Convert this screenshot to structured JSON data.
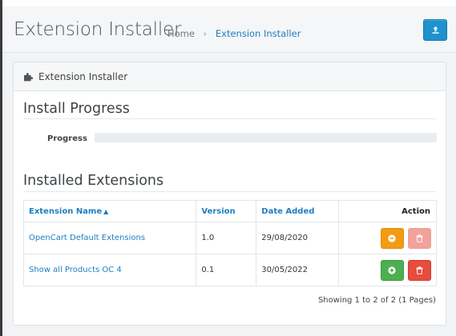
{
  "header": {
    "title": "Extension Installer",
    "breadcrumb": [
      {
        "label": "Home"
      },
      {
        "label": "Extension Installer"
      }
    ],
    "upload_icon": "upload-icon",
    "accent": "#1e91cf"
  },
  "panel": {
    "heading": "Extension Installer",
    "heading_icon": "puzzle-icon"
  },
  "install_progress": {
    "title": "Install Progress",
    "label": "Progress",
    "value_percent": 0
  },
  "installed": {
    "title": "Installed Extensions",
    "columns": {
      "name": "Extension Name",
      "version": "Version",
      "date_added": "Date Added",
      "action": "Action"
    },
    "rows": [
      {
        "name": "OpenCart Default Extensions",
        "version": "1.0",
        "date_added": "29/08/2020",
        "primary_action": {
          "icon": "minus-circle-icon",
          "style": "warning",
          "color": "#f39c12"
        },
        "delete_action": {
          "icon": "trash-icon",
          "style": "danger",
          "disabled": true,
          "color": "#f2a29a"
        }
      },
      {
        "name": "Show all Products OC 4",
        "version": "0.1",
        "date_added": "30/05/2022",
        "primary_action": {
          "icon": "plus-circle-icon",
          "style": "success",
          "color": "#4caf50"
        },
        "delete_action": {
          "icon": "trash-icon",
          "style": "danger",
          "disabled": false,
          "color": "#e74c3c"
        }
      }
    ],
    "pagination_text": "Showing 1 to 2 of 2 (1 Pages)"
  }
}
